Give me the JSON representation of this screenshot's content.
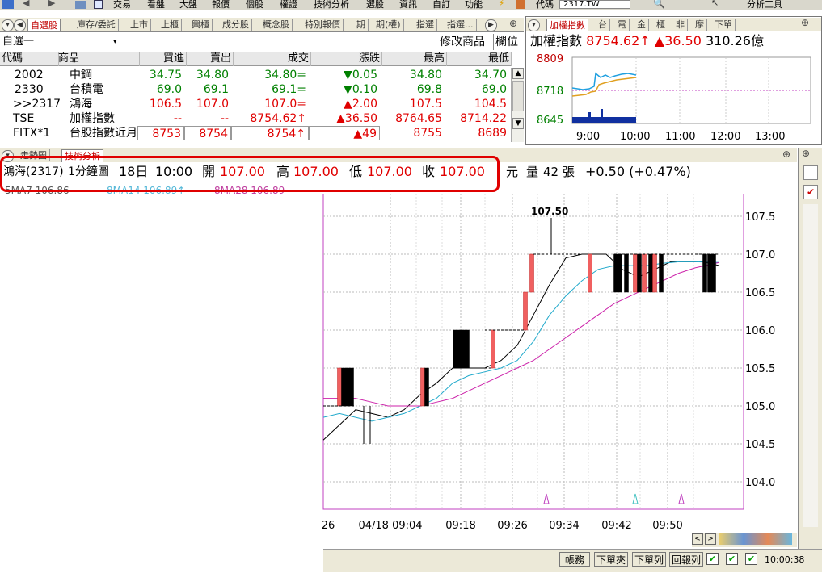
{
  "menubar": {
    "items": [
      "交易",
      "看盤",
      "大盤",
      "報價",
      "個股",
      "權證",
      "技術分析",
      "選股",
      "資訊",
      "自訂",
      "功能"
    ],
    "code_label": "代碼",
    "code_value": "2317.TW",
    "analysis_tools": "分析工具"
  },
  "watchlist": {
    "tabs": [
      "自選股",
      "庫存/委託",
      "上市",
      "上櫃",
      "興櫃",
      "成分股",
      "概念股",
      "特別報價",
      "期",
      "期(權)",
      "指選",
      "指選..."
    ],
    "group_name": "自選一",
    "modify_button": "修改商品",
    "columns_button": "欄位",
    "headers": [
      "代碼",
      "商品",
      "買進",
      "賣出",
      "成交",
      "漲跌",
      "最高",
      "最低"
    ],
    "rows": [
      {
        "code": "2002",
        "name": "中鋼",
        "bid": "34.75",
        "ask": "34.80",
        "last": "34.80=",
        "change": "▼0.05",
        "high": "34.80",
        "low": "34.70",
        "dir": "dn"
      },
      {
        "code": "2330",
        "name": "台積電",
        "bid": "69.0",
        "ask": "69.1",
        "last": "69.1=",
        "change": "▼0.10",
        "high": "69.8",
        "low": "69.0",
        "dir": "dn"
      },
      {
        "code": ">>2317",
        "name": "鴻海",
        "bid": "106.5",
        "ask": "107.0",
        "last": "107.0=",
        "change": "▲2.00",
        "high": "107.5",
        "low": "104.5",
        "dir": "up"
      },
      {
        "code": "TSE",
        "name": "加權指數",
        "bid": "--",
        "ask": "--",
        "last": "8754.62↑",
        "change": "▲36.50",
        "high": "8764.65",
        "low": "8714.22",
        "dir": "up"
      },
      {
        "code": "FITX*1",
        "name": "台股指數近月",
        "bid": "8753",
        "ask": "8754",
        "last": "8754↑",
        "change": "▲49",
        "high": "8755",
        "low": "8689",
        "dir": "up"
      }
    ]
  },
  "index_panel": {
    "tabs": [
      "加權指數",
      "台",
      "電",
      "金",
      "櫃",
      "非",
      "摩",
      "下單"
    ],
    "name": "加權指數",
    "value": "8754.62↑",
    "change": "▲36.50",
    "volume": "310.26億",
    "y_ticks": [
      "8809",
      "8718",
      "8645"
    ],
    "x_ticks": [
      "9:00",
      "10:00",
      "11:00",
      "12:00",
      "13:00"
    ]
  },
  "chart_tabs": [
    "走勢圖",
    "技術分析"
  ],
  "info_bar": {
    "stock": "鴻海(2317)",
    "period": "1分鐘圖",
    "date": "18日",
    "time": "10:00",
    "open_label": "開",
    "open": "107.00",
    "high_label": "高",
    "high": "107.00",
    "low_label": "低",
    "low": "107.00",
    "close_label": "收",
    "close": "107.00",
    "unit": "元",
    "vol_label": "量",
    "vol": "42",
    "vol_unit": "張",
    "change": "+0.50 (+0.47%)"
  },
  "ma_legend": [
    "5MA7 106.86",
    "8MA14 106.89↑",
    "8MA28 106.89"
  ],
  "chart_data": {
    "type": "candlestick",
    "y_ticks": [
      "107.5",
      "107.0",
      "106.5",
      "106.0",
      "105.5",
      "105.0",
      "104.5",
      "104.0"
    ],
    "ylim": [
      103.7,
      107.98
    ],
    "x_ticks": [
      "26",
      "04/18 09:04",
      "09:18",
      "09:26",
      "09:34",
      "09:42",
      "09:50"
    ],
    "high_annotation": "107.50",
    "candles": [
      {
        "x": 420,
        "o": 105.5,
        "c": 105.0,
        "h": 105.5,
        "l": 105.0,
        "color": "red"
      },
      {
        "x": 425,
        "o": 105.5,
        "c": 105.0,
        "h": 105.5,
        "l": 105.0,
        "color": "black"
      },
      {
        "x": 430,
        "o": 105.5,
        "c": 105.0,
        "h": 105.5,
        "l": 105.0,
        "color": "black"
      },
      {
        "x": 435,
        "o": 105.5,
        "c": 105.0,
        "h": 105.5,
        "l": 105.0,
        "color": "black"
      },
      {
        "x": 523,
        "o": 105.0,
        "c": 105.5,
        "h": 105.5,
        "l": 105.0,
        "color": "red"
      },
      {
        "x": 528,
        "o": 105.5,
        "c": 105.0,
        "h": 105.5,
        "l": 105.0,
        "color": "black"
      },
      {
        "x": 563,
        "o": 106.0,
        "c": 105.5,
        "h": 106.0,
        "l": 105.5,
        "color": "black"
      },
      {
        "x": 568,
        "o": 106.0,
        "c": 105.5,
        "h": 106.0,
        "l": 105.5,
        "color": "black"
      },
      {
        "x": 573,
        "o": 106.0,
        "c": 105.5,
        "h": 106.0,
        "l": 105.5,
        "color": "black"
      },
      {
        "x": 578,
        "o": 106.0,
        "c": 105.5,
        "h": 106.0,
        "l": 105.5,
        "color": "black"
      },
      {
        "x": 610,
        "o": 105.5,
        "c": 106.0,
        "h": 106.0,
        "l": 105.5,
        "color": "red"
      },
      {
        "x": 650,
        "o": 106.0,
        "c": 106.5,
        "h": 106.5,
        "l": 106.0,
        "color": "red"
      },
      {
        "x": 658,
        "o": 106.5,
        "c": 107.0,
        "h": 107.0,
        "l": 106.5,
        "color": "red"
      },
      {
        "x": 730,
        "o": 106.5,
        "c": 107.0,
        "h": 107.0,
        "l": 106.5,
        "color": "red"
      },
      {
        "x": 762,
        "o": 107.0,
        "c": 106.5,
        "h": 107.0,
        "l": 106.5,
        "color": "black"
      },
      {
        "x": 767,
        "o": 107.0,
        "c": 106.5,
        "h": 107.0,
        "l": 106.5,
        "color": "black"
      },
      {
        "x": 775,
        "o": 107.0,
        "c": 106.5,
        "h": 107.0,
        "l": 106.5,
        "color": "black"
      },
      {
        "x": 786,
        "o": 106.5,
        "c": 107.0,
        "h": 107.0,
        "l": 106.5,
        "color": "red"
      },
      {
        "x": 791,
        "o": 107.0,
        "c": 106.5,
        "h": 107.0,
        "l": 106.5,
        "color": "black"
      },
      {
        "x": 797,
        "o": 106.5,
        "c": 107.0,
        "h": 107.0,
        "l": 106.5,
        "color": "red"
      },
      {
        "x": 805,
        "o": 107.0,
        "c": 106.5,
        "h": 107.0,
        "l": 106.5,
        "color": "black"
      },
      {
        "x": 810,
        "o": 106.5,
        "c": 107.0,
        "h": 107.0,
        "l": 106.5,
        "color": "red"
      },
      {
        "x": 818,
        "o": 107.0,
        "c": 106.5,
        "h": 107.0,
        "l": 106.5,
        "color": "black"
      },
      {
        "x": 872,
        "o": 107.0,
        "c": 106.5,
        "h": 107.0,
        "l": 106.5,
        "color": "black"
      },
      {
        "x": 878,
        "o": 107.0,
        "c": 106.5,
        "h": 107.0,
        "l": 106.5,
        "color": "black"
      },
      {
        "x": 883,
        "o": 107.0,
        "c": 106.5,
        "h": 107.0,
        "l": 106.5,
        "color": "black"
      }
    ],
    "series": [
      {
        "name": "5MA7",
        "color": "#000000",
        "points": [
          [
            400,
            104.55
          ],
          [
            420,
            104.75
          ],
          [
            440,
            104.95
          ],
          [
            460,
            104.9
          ],
          [
            480,
            104.85
          ],
          [
            500,
            104.95
          ],
          [
            520,
            105.15
          ],
          [
            540,
            105.3
          ],
          [
            560,
            105.5
          ],
          [
            580,
            105.5
          ],
          [
            600,
            105.5
          ],
          [
            620,
            105.6
          ],
          [
            640,
            105.8
          ],
          [
            660,
            106.2
          ],
          [
            680,
            106.6
          ],
          [
            700,
            106.95
          ],
          [
            720,
            107.0
          ],
          [
            750,
            107.0
          ],
          [
            770,
            106.8
          ],
          [
            790,
            106.7
          ],
          [
            810,
            106.8
          ],
          [
            830,
            106.9
          ],
          [
            850,
            106.9
          ],
          [
            870,
            106.9
          ],
          [
            890,
            106.85
          ]
        ]
      },
      {
        "name": "8MA14",
        "color": "#22aacc",
        "points": [
          [
            400,
            104.85
          ],
          [
            420,
            104.9
          ],
          [
            440,
            104.85
          ],
          [
            460,
            104.8
          ],
          [
            480,
            104.85
          ],
          [
            500,
            104.9
          ],
          [
            520,
            105.0
          ],
          [
            540,
            105.1
          ],
          [
            560,
            105.3
          ],
          [
            580,
            105.4
          ],
          [
            600,
            105.45
          ],
          [
            620,
            105.5
          ],
          [
            640,
            105.6
          ],
          [
            660,
            105.85
          ],
          [
            680,
            106.2
          ],
          [
            700,
            106.45
          ],
          [
            720,
            106.65
          ],
          [
            740,
            106.8
          ],
          [
            760,
            106.85
          ],
          [
            780,
            106.85
          ],
          [
            800,
            106.85
          ],
          [
            820,
            106.88
          ],
          [
            840,
            106.9
          ],
          [
            860,
            106.9
          ],
          [
            890,
            106.89
          ]
        ]
      },
      {
        "name": "8MA28",
        "color": "#cc22aa",
        "points": [
          [
            400,
            105.1
          ],
          [
            420,
            105.1
          ],
          [
            440,
            105.1
          ],
          [
            460,
            105.05
          ],
          [
            480,
            105.0
          ],
          [
            500,
            105.0
          ],
          [
            520,
            105.0
          ],
          [
            540,
            105.05
          ],
          [
            560,
            105.1
          ],
          [
            580,
            105.2
          ],
          [
            600,
            105.3
          ],
          [
            620,
            105.4
          ],
          [
            640,
            105.5
          ],
          [
            660,
            105.6
          ],
          [
            680,
            105.75
          ],
          [
            700,
            105.9
          ],
          [
            720,
            106.05
          ],
          [
            740,
            106.2
          ],
          [
            760,
            106.35
          ],
          [
            780,
            106.45
          ],
          [
            800,
            106.55
          ],
          [
            820,
            106.65
          ],
          [
            840,
            106.75
          ],
          [
            860,
            106.82
          ],
          [
            890,
            106.89
          ]
        ]
      }
    ]
  },
  "bottom_bar": {
    "buttons": [
      "帳務",
      "下單夾",
      "下單列",
      "回報列"
    ],
    "clock": "10:00:38"
  }
}
